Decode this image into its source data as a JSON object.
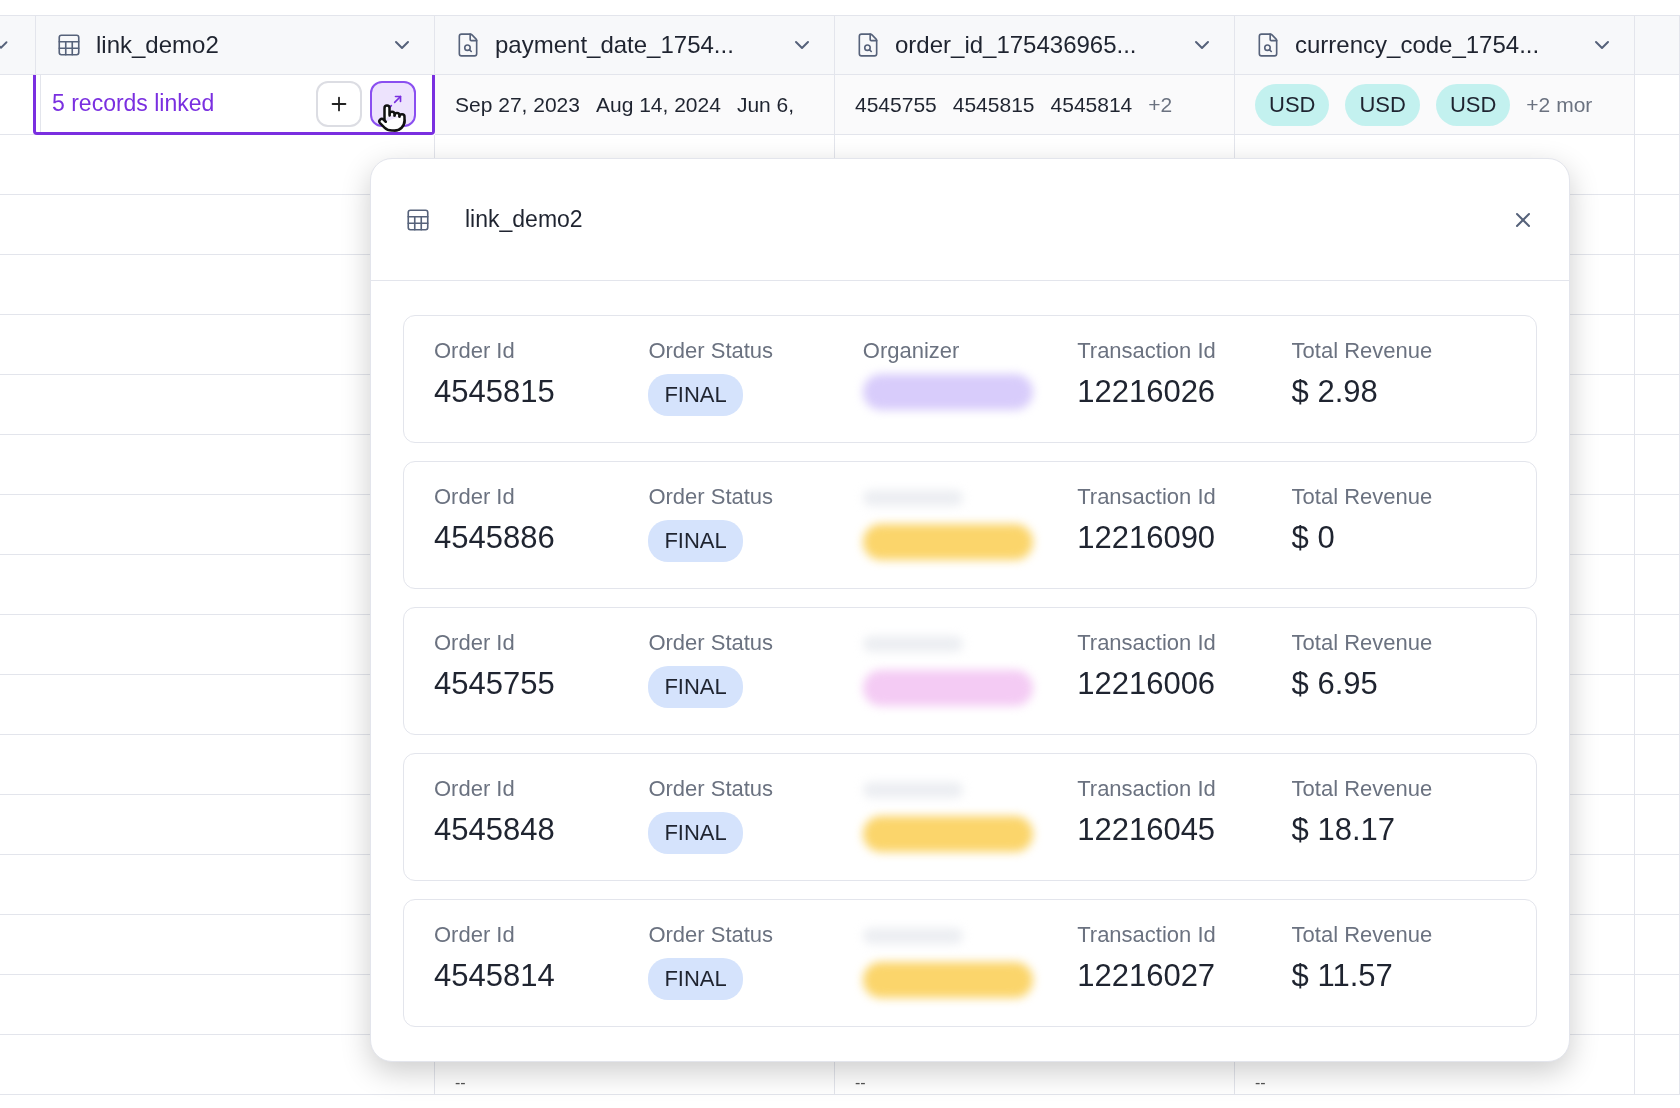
{
  "table": {
    "columns": [
      {
        "kind": "partial"
      },
      {
        "label": "link_demo2",
        "kind": "link"
      },
      {
        "label": "payment_date_1754...",
        "kind": "lookup"
      },
      {
        "label": "order_id_175436965...",
        "kind": "lookup"
      },
      {
        "label": "currency_code_1754...",
        "kind": "lookup"
      }
    ],
    "row": {
      "linked_text": "5 records linked",
      "selected": true,
      "dates": [
        "Sep 27, 2023",
        "Aug 14, 2024",
        "Jun 6,"
      ],
      "order_ids": [
        "4545755",
        "4545815",
        "4545814"
      ],
      "order_more": "+2",
      "currencies": [
        "USD",
        "USD",
        "USD"
      ],
      "currency_more": "+2 mor"
    },
    "last_row": [
      "--",
      "--",
      "--"
    ]
  },
  "popup": {
    "title": "link_demo2",
    "records": [
      {
        "fields": [
          {
            "kind": "text",
            "label": "Order Id",
            "value": "4545815"
          },
          {
            "kind": "tag",
            "label": "Order Status",
            "value": "FINAL"
          },
          {
            "kind": "redacted",
            "label": "Organizer",
            "color": "#d8ccfb"
          },
          {
            "kind": "text",
            "label": "Transaction Id",
            "value": "12216026"
          },
          {
            "kind": "text",
            "label": "Total Revenue",
            "value": "$ 2.98"
          }
        ]
      },
      {
        "fields": [
          {
            "kind": "text",
            "label": "Order Id",
            "value": "4545886"
          },
          {
            "kind": "tag",
            "label": "Order Status",
            "value": "FINAL"
          },
          {
            "kind": "redacted",
            "color": "#fbd56b"
          },
          {
            "kind": "text",
            "label": "Transaction Id",
            "value": "12216090"
          },
          {
            "kind": "text",
            "label": "Total Revenue",
            "value": "$ 0"
          }
        ]
      },
      {
        "fields": [
          {
            "kind": "text",
            "label": "Order Id",
            "value": "4545755"
          },
          {
            "kind": "tag",
            "label": "Order Status",
            "value": "FINAL"
          },
          {
            "kind": "redacted",
            "color": "#f4cbf4"
          },
          {
            "kind": "text",
            "label": "Transaction Id",
            "value": "12216006"
          },
          {
            "kind": "text",
            "label": "Total Revenue",
            "value": "$ 6.95"
          }
        ]
      },
      {
        "fields": [
          {
            "kind": "text",
            "label": "Order Id",
            "value": "4545848"
          },
          {
            "kind": "tag",
            "label": "Order Status",
            "value": "FINAL"
          },
          {
            "kind": "redacted",
            "color": "#fbd56b"
          },
          {
            "kind": "text",
            "label": "Transaction Id",
            "value": "12216045"
          },
          {
            "kind": "text",
            "label": "Total Revenue",
            "value": "$ 18.17"
          }
        ]
      },
      {
        "fields": [
          {
            "kind": "text",
            "label": "Order Id",
            "value": "4545814"
          },
          {
            "kind": "tag",
            "label": "Order Status",
            "value": "FINAL"
          },
          {
            "kind": "redacted",
            "color": "#fbd56b"
          },
          {
            "kind": "text",
            "label": "Transaction Id",
            "value": "12216027"
          },
          {
            "kind": "text",
            "label": "Total Revenue",
            "value": "$ 11.57"
          }
        ]
      }
    ]
  }
}
